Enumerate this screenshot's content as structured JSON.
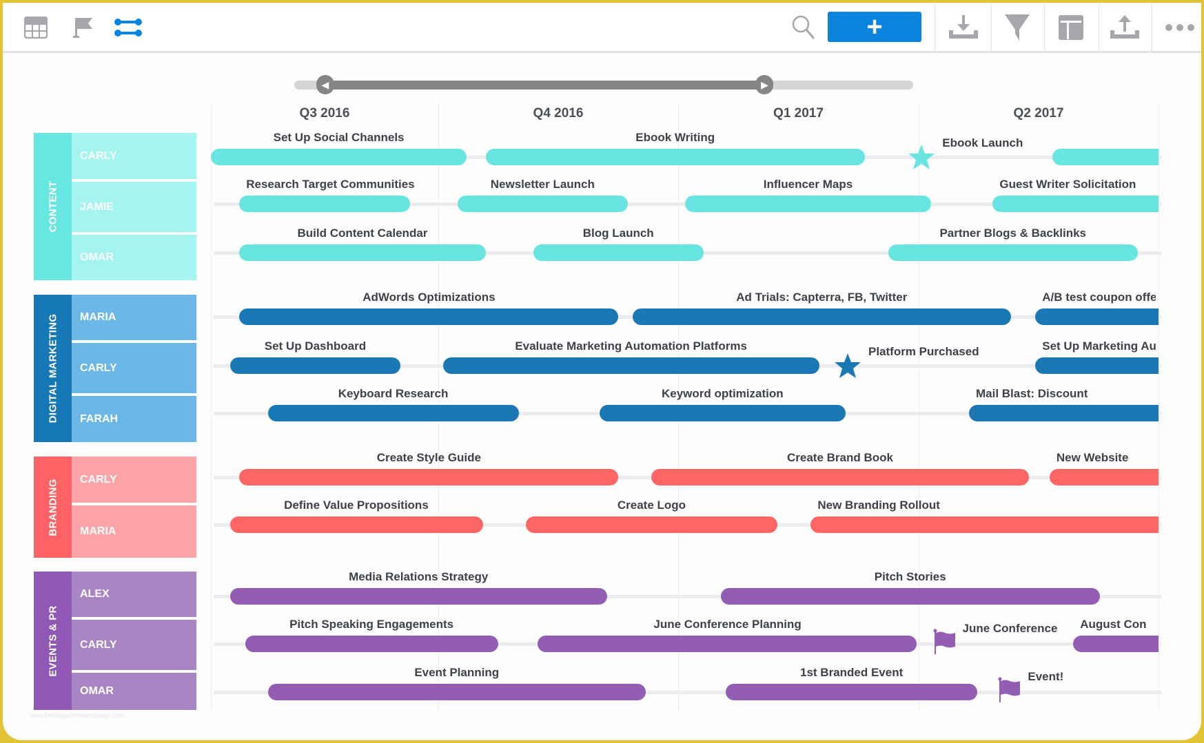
{
  "toolbar": {
    "left_icons": [
      "table-view-icon",
      "milestone-flag-icon",
      "timeline-view-icon"
    ],
    "active_view": "timeline-view-icon",
    "add_label": "+",
    "right_icons": [
      "download-icon",
      "filter-icon",
      "layout-icon",
      "upload-icon",
      "more-icon"
    ],
    "accent": "#0a84dc"
  },
  "range_slider": {
    "min": 0,
    "max": 1,
    "start": 0.05,
    "end": 0.76
  },
  "quarters": [
    "Q3 2016",
    "Q4 2016",
    "Q1 2017",
    "Q2 2017"
  ],
  "groups": [
    {
      "name": "CONTENT",
      "band_color": "#68e6e1",
      "member_color": "#a4f4f0",
      "bar_color": "#69e5e1",
      "members": [
        {
          "name": "CARLY",
          "tasks": [
            {
              "label": "Set Up Social Channels",
              "type": "bar",
              "start": 0.0,
              "end": 0.27
            },
            {
              "label": "Ebook Writing",
              "type": "bar",
              "start": 0.29,
              "end": 0.69
            },
            {
              "label": "Ebook Launch",
              "type": "star",
              "at": 0.75
            },
            {
              "label": "",
              "type": "bar",
              "start": 0.888,
              "end": 1.0
            }
          ]
        },
        {
          "name": "JAMIE",
          "tasks": [
            {
              "label": "Research Target Communities",
              "type": "bar",
              "start": 0.03,
              "end": 0.21
            },
            {
              "label": "Newsletter Launch",
              "type": "bar",
              "start": 0.26,
              "end": 0.44
            },
            {
              "label": "Influencer Maps",
              "type": "bar",
              "start": 0.5,
              "end": 0.76
            },
            {
              "label": "Guest Writer Solicitation",
              "type": "bar",
              "start": 0.825,
              "end": 1.0
            }
          ]
        },
        {
          "name": "OMAR",
          "tasks": [
            {
              "label": "Build Content Calendar",
              "type": "bar",
              "start": 0.03,
              "end": 0.29
            },
            {
              "label": "Blog Launch",
              "type": "bar",
              "start": 0.34,
              "end": 0.52
            },
            {
              "label": "Partner Blogs & Backlinks",
              "type": "bar",
              "start": 0.715,
              "end": 0.978
            }
          ]
        }
      ]
    },
    {
      "name": "DIGITAL MARKETING",
      "band_color": "#1678b4",
      "member_color": "#6bb7e8",
      "bar_color": "#1a78b4",
      "members": [
        {
          "name": "MARIA",
          "tasks": [
            {
              "label": "AdWords Optimizations",
              "type": "bar",
              "start": 0.03,
              "end": 0.43
            },
            {
              "label": "Ad Trials: Capterra, FB, Twitter",
              "type": "bar",
              "start": 0.445,
              "end": 0.844
            },
            {
              "label": "A/B test coupon offe",
              "type": "bar",
              "start": 0.87,
              "end": 1.0
            }
          ]
        },
        {
          "name": "CARLY",
          "tasks": [
            {
              "label": "Set Up Dashboard",
              "type": "bar",
              "start": 0.02,
              "end": 0.2
            },
            {
              "label": "Evaluate Marketing Automation Platforms",
              "type": "bar",
              "start": 0.245,
              "end": 0.642
            },
            {
              "label": "Platform Purchased",
              "type": "star",
              "at": 0.672
            },
            {
              "label": "Set Up Marketing Au",
              "type": "bar",
              "start": 0.87,
              "end": 1.0
            }
          ]
        },
        {
          "name": "FARAH",
          "tasks": [
            {
              "label": "Keyboard Research",
              "type": "bar",
              "start": 0.06,
              "end": 0.325
            },
            {
              "label": "Keyword optimization",
              "type": "bar",
              "start": 0.41,
              "end": 0.67
            },
            {
              "label": "Mail Blast: Discount",
              "type": "bar",
              "start": 0.8,
              "end": 1.0
            }
          ]
        }
      ]
    },
    {
      "name": "BRANDING",
      "band_color": "#ff6264",
      "member_color": "#fda5a6",
      "bar_color": "#fe6565",
      "members": [
        {
          "name": "CARLY",
          "tasks": [
            {
              "label": "Create Style Guide",
              "type": "bar",
              "start": 0.03,
              "end": 0.43
            },
            {
              "label": "Create Brand Book",
              "type": "bar",
              "start": 0.465,
              "end": 0.863
            },
            {
              "label": "New Website",
              "type": "bar",
              "start": 0.885,
              "end": 1.0
            }
          ]
        },
        {
          "name": "MARIA",
          "tasks": [
            {
              "label": "Define Value Propositions",
              "type": "bar",
              "start": 0.02,
              "end": 0.287
            },
            {
              "label": "Create Logo",
              "type": "bar",
              "start": 0.332,
              "end": 0.598
            },
            {
              "label": "New Branding Rollout",
              "type": "bar",
              "start": 0.633,
              "end": 1.0
            }
          ]
        }
      ]
    },
    {
      "name": "EVENTS & PR",
      "band_color": "#9157b4",
      "member_color": "#a786c3",
      "bar_color": "#925db3",
      "members": [
        {
          "name": "ALEX",
          "tasks": [
            {
              "label": "Media Relations Strategy",
              "type": "bar",
              "start": 0.02,
              "end": 0.418
            },
            {
              "label": "Pitch Stories",
              "type": "bar",
              "start": 0.538,
              "end": 0.938
            }
          ]
        },
        {
          "name": "CARLY",
          "tasks": [
            {
              "label": "Pitch Speaking Engagements",
              "type": "bar",
              "start": 0.036,
              "end": 0.303
            },
            {
              "label": "June Conference Planning",
              "type": "bar",
              "start": 0.345,
              "end": 0.745
            },
            {
              "label": "June Conference",
              "type": "flag",
              "at": 0.764
            },
            {
              "label": "August Con",
              "type": "bar",
              "start": 0.91,
              "end": 1.0
            }
          ]
        },
        {
          "name": "OMAR",
          "tasks": [
            {
              "label": "Event Planning",
              "type": "bar",
              "start": 0.06,
              "end": 0.459
            },
            {
              "label": "1st Branded Event",
              "type": "bar",
              "start": 0.543,
              "end": 0.809
            },
            {
              "label": "Event!",
              "type": "flag",
              "at": 0.833
            }
          ]
        }
      ]
    }
  ],
  "watermark": "www.heritagechristiancollege.com"
}
